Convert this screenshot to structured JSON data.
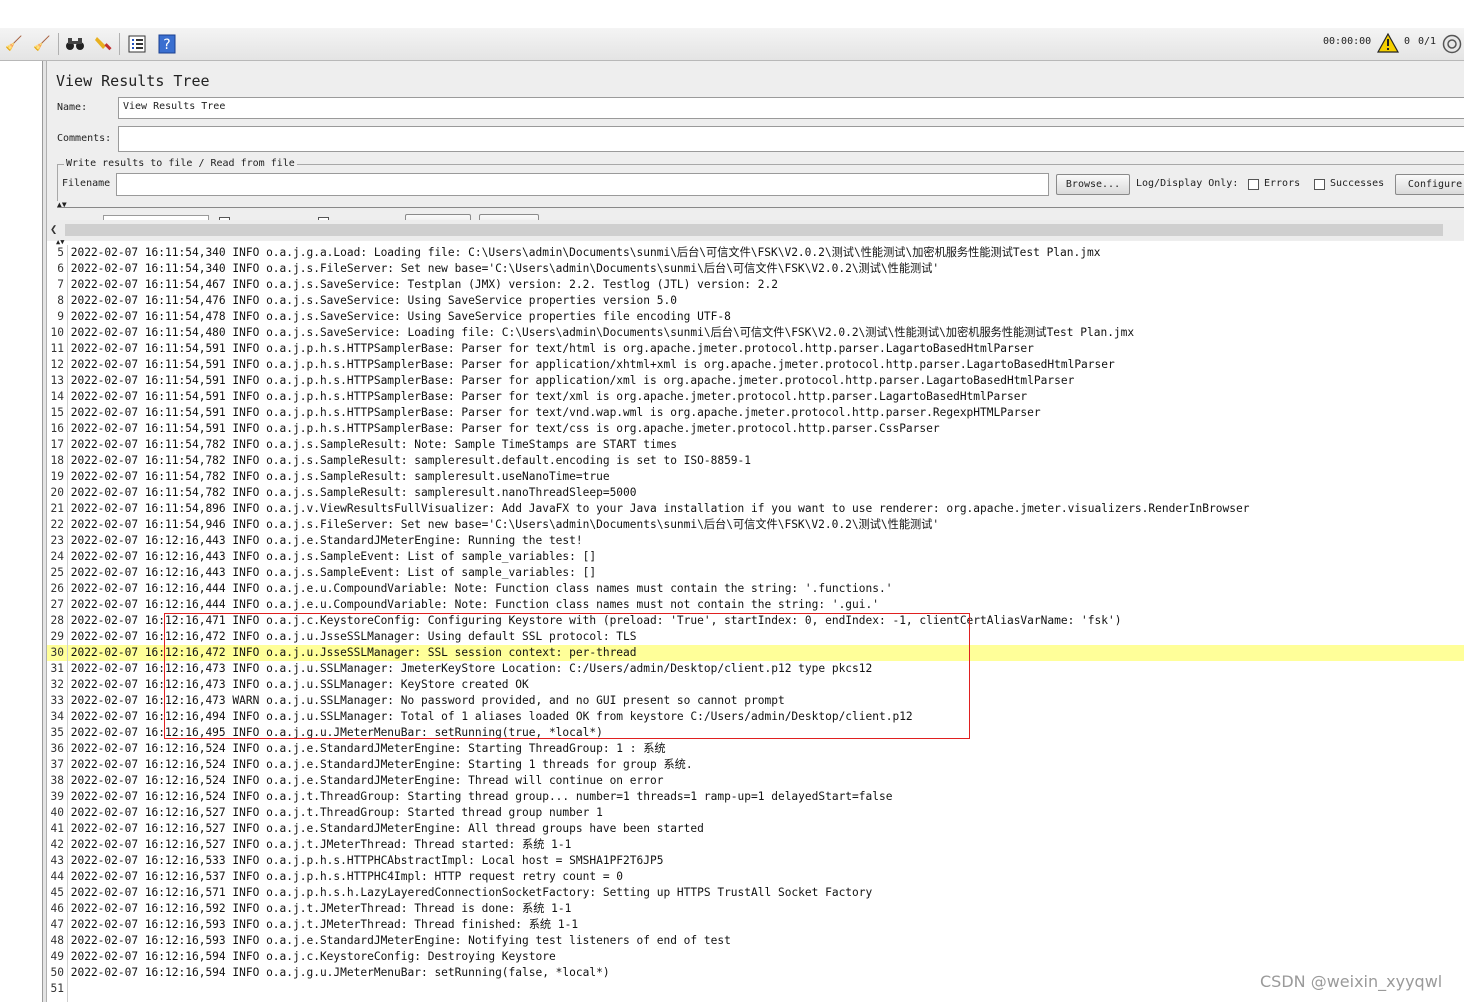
{
  "toolbar": {
    "timer": "00:00:00",
    "warning_count": "0",
    "threads": "0/1"
  },
  "panel": {
    "title": "View Results Tree",
    "name_label": "Name:",
    "name_value": "View Results Tree",
    "comments_label": "Comments:",
    "comments_value": "",
    "file_section_label": "Write results to file / Read from file",
    "filename_label": "Filename",
    "filename_value": "",
    "browse_label": "Browse...",
    "log_display_label": "Log/Display Only:",
    "errors_label": "Errors",
    "successes_label": "Successes",
    "configure_label": "Configure"
  },
  "log": {
    "highlighted_line": 30,
    "lines": [
      {
        "n": "5",
        "t": "2022-02-07 16:11:54,340 INFO o.a.j.g.a.Load: Loading file: C:\\Users\\admin\\Documents\\sunmi\\后台\\可信文件\\FSK\\V2.0.2\\测试\\性能测试\\加密机服务性能测试Test Plan.jmx"
      },
      {
        "n": "6",
        "t": "2022-02-07 16:11:54,340 INFO o.a.j.s.FileServer: Set new base='C:\\Users\\admin\\Documents\\sunmi\\后台\\可信文件\\FSK\\V2.0.2\\测试\\性能测试'"
      },
      {
        "n": "7",
        "t": "2022-02-07 16:11:54,467 INFO o.a.j.s.SaveService: Testplan (JMX) version: 2.2. Testlog (JTL) version: 2.2"
      },
      {
        "n": "8",
        "t": "2022-02-07 16:11:54,476 INFO o.a.j.s.SaveService: Using SaveService properties version 5.0"
      },
      {
        "n": "9",
        "t": "2022-02-07 16:11:54,478 INFO o.a.j.s.SaveService: Using SaveService properties file encoding UTF-8"
      },
      {
        "n": "10",
        "t": "2022-02-07 16:11:54,480 INFO o.a.j.s.SaveService: Loading file: C:\\Users\\admin\\Documents\\sunmi\\后台\\可信文件\\FSK\\V2.0.2\\测试\\性能测试\\加密机服务性能测试Test Plan.jmx"
      },
      {
        "n": "11",
        "t": "2022-02-07 16:11:54,591 INFO o.a.j.p.h.s.HTTPSamplerBase: Parser for text/html is org.apache.jmeter.protocol.http.parser.LagartoBasedHtmlParser"
      },
      {
        "n": "12",
        "t": "2022-02-07 16:11:54,591 INFO o.a.j.p.h.s.HTTPSamplerBase: Parser for application/xhtml+xml is org.apache.jmeter.protocol.http.parser.LagartoBasedHtmlParser"
      },
      {
        "n": "13",
        "t": "2022-02-07 16:11:54,591 INFO o.a.j.p.h.s.HTTPSamplerBase: Parser for application/xml is org.apache.jmeter.protocol.http.parser.LagartoBasedHtmlParser"
      },
      {
        "n": "14",
        "t": "2022-02-07 16:11:54,591 INFO o.a.j.p.h.s.HTTPSamplerBase: Parser for text/xml is org.apache.jmeter.protocol.http.parser.LagartoBasedHtmlParser"
      },
      {
        "n": "15",
        "t": "2022-02-07 16:11:54,591 INFO o.a.j.p.h.s.HTTPSamplerBase: Parser for text/vnd.wap.wml is org.apache.jmeter.protocol.http.parser.RegexpHTMLParser"
      },
      {
        "n": "16",
        "t": "2022-02-07 16:11:54,591 INFO o.a.j.p.h.s.HTTPSamplerBase: Parser for text/css is org.apache.jmeter.protocol.http.parser.CssParser"
      },
      {
        "n": "17",
        "t": "2022-02-07 16:11:54,782 INFO o.a.j.s.SampleResult: Note: Sample TimeStamps are START times"
      },
      {
        "n": "18",
        "t": "2022-02-07 16:11:54,782 INFO o.a.j.s.SampleResult: sampleresult.default.encoding is set to ISO-8859-1"
      },
      {
        "n": "19",
        "t": "2022-02-07 16:11:54,782 INFO o.a.j.s.SampleResult: sampleresult.useNanoTime=true"
      },
      {
        "n": "20",
        "t": "2022-02-07 16:11:54,782 INFO o.a.j.s.SampleResult: sampleresult.nanoThreadSleep=5000"
      },
      {
        "n": "21",
        "t": "2022-02-07 16:11:54,896 INFO o.a.j.v.ViewResultsFullVisualizer: Add JavaFX to your Java installation if you want to use renderer: org.apache.jmeter.visualizers.RenderInBrowser"
      },
      {
        "n": "22",
        "t": "2022-02-07 16:11:54,946 INFO o.a.j.s.FileServer: Set new base='C:\\Users\\admin\\Documents\\sunmi\\后台\\可信文件\\FSK\\V2.0.2\\测试\\性能测试'"
      },
      {
        "n": "23",
        "t": "2022-02-07 16:12:16,443 INFO o.a.j.e.StandardJMeterEngine: Running the test!"
      },
      {
        "n": "24",
        "t": "2022-02-07 16:12:16,443 INFO o.a.j.s.SampleEvent: List of sample_variables: []"
      },
      {
        "n": "25",
        "t": "2022-02-07 16:12:16,443 INFO o.a.j.s.SampleEvent: List of sample_variables: []"
      },
      {
        "n": "26",
        "t": "2022-02-07 16:12:16,444 INFO o.a.j.e.u.CompoundVariable: Note: Function class names must contain the string: '.functions.'"
      },
      {
        "n": "27",
        "t": "2022-02-07 16:12:16,444 INFO o.a.j.e.u.CompoundVariable: Note: Function class names must not contain the string: '.gui.'"
      },
      {
        "n": "28",
        "t": "2022-02-07 16:12:16,471 INFO o.a.j.c.KeystoreConfig: Configuring Keystore with (preload: 'True', startIndex: 0, endIndex: -1, clientCertAliasVarName: 'fsk')"
      },
      {
        "n": "29",
        "t": "2022-02-07 16:12:16,472 INFO o.a.j.u.JsseSSLManager: Using default SSL protocol: TLS"
      },
      {
        "n": "30",
        "t": "2022-02-07 16:12:16,472 INFO o.a.j.u.JsseSSLManager: SSL session context: per-thread"
      },
      {
        "n": "31",
        "t": "2022-02-07 16:12:16,473 INFO o.a.j.u.SSLManager: JmeterKeyStore Location: C:/Users/admin/Desktop/client.p12 type pkcs12"
      },
      {
        "n": "32",
        "t": "2022-02-07 16:12:16,473 INFO o.a.j.u.SSLManager: KeyStore created OK"
      },
      {
        "n": "33",
        "t": "2022-02-07 16:12:16,473 WARN o.a.j.u.SSLManager: No password provided, and no GUI present so cannot prompt"
      },
      {
        "n": "34",
        "t": "2022-02-07 16:12:16,494 INFO o.a.j.u.SSLManager: Total of 1 aliases loaded OK from keystore C:/Users/admin/Desktop/client.p12"
      },
      {
        "n": "35",
        "t": "2022-02-07 16:12:16,495 INFO o.a.j.g.u.JMeterMenuBar: setRunning(true, *local*)"
      },
      {
        "n": "36",
        "t": "2022-02-07 16:12:16,524 INFO o.a.j.e.StandardJMeterEngine: Starting ThreadGroup: 1 : 系统"
      },
      {
        "n": "37",
        "t": "2022-02-07 16:12:16,524 INFO o.a.j.e.StandardJMeterEngine: Starting 1 threads for group 系统."
      },
      {
        "n": "38",
        "t": "2022-02-07 16:12:16,524 INFO o.a.j.e.StandardJMeterEngine: Thread will continue on error"
      },
      {
        "n": "39",
        "t": "2022-02-07 16:12:16,524 INFO o.a.j.t.ThreadGroup: Starting thread group... number=1 threads=1 ramp-up=1 delayedStart=false"
      },
      {
        "n": "40",
        "t": "2022-02-07 16:12:16,527 INFO o.a.j.t.ThreadGroup: Started thread group number 1"
      },
      {
        "n": "41",
        "t": "2022-02-07 16:12:16,527 INFO o.a.j.e.StandardJMeterEngine: All thread groups have been started"
      },
      {
        "n": "42",
        "t": "2022-02-07 16:12:16,527 INFO o.a.j.t.JMeterThread: Thread started: 系统 1-1"
      },
      {
        "n": "43",
        "t": "2022-02-07 16:12:16,533 INFO o.a.j.p.h.s.HTTPHCAbstractImpl: Local host = SMSHA1PF2T6JP5"
      },
      {
        "n": "44",
        "t": "2022-02-07 16:12:16,537 INFO o.a.j.p.h.s.HTTPHC4Impl: HTTP request retry count = 0"
      },
      {
        "n": "45",
        "t": "2022-02-07 16:12:16,571 INFO o.a.j.p.h.s.h.LazyLayeredConnectionSocketFactory: Setting up HTTPS TrustAll Socket Factory"
      },
      {
        "n": "46",
        "t": "2022-02-07 16:12:16,592 INFO o.a.j.t.JMeterThread: Thread is done: 系统 1-1"
      },
      {
        "n": "47",
        "t": "2022-02-07 16:12:16,593 INFO o.a.j.t.JMeterThread: Thread finished: 系统 1-1"
      },
      {
        "n": "48",
        "t": "2022-02-07 16:12:16,593 INFO o.a.j.e.StandardJMeterEngine: Notifying test listeners of end of test"
      },
      {
        "n": "49",
        "t": "2022-02-07 16:12:16,594 INFO o.a.j.c.KeystoreConfig: Destroying Keystore"
      },
      {
        "n": "50",
        "t": "2022-02-07 16:12:16,594 INFO o.a.j.g.u.JMeterMenuBar: setRunning(false, *local*)"
      },
      {
        "n": "51",
        "t": ""
      }
    ]
  },
  "watermark": "CSDN @weixin_xyyqwl"
}
